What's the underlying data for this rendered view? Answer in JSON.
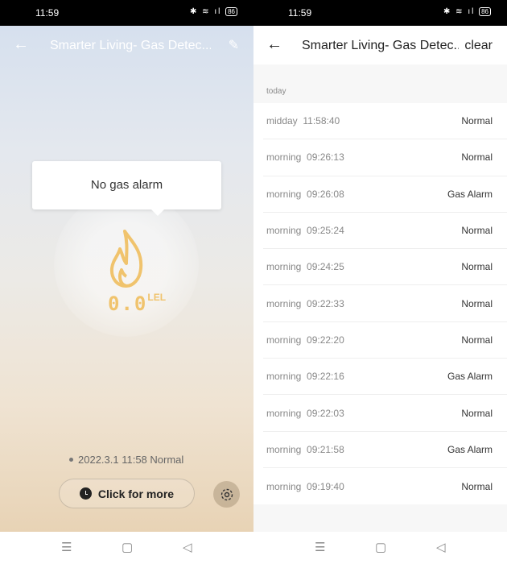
{
  "status_bar": {
    "time": "11:59",
    "battery": "86"
  },
  "left": {
    "header": {
      "title": "Smarter Living- Gas Detec..."
    },
    "bubble": "No gas alarm",
    "reading": {
      "value": "0.0",
      "unit": "LEL"
    },
    "last_record": "2022.3.1 11:58 Normal",
    "more_button": "Click for more",
    "accent": "#f0c36d"
  },
  "right": {
    "header": {
      "title": "Smarter Living- Gas Detec...",
      "clear": "clear"
    },
    "section": "today",
    "records": [
      {
        "period": "midday",
        "time": "11:58:40",
        "status": "Normal"
      },
      {
        "period": "morning",
        "time": "09:26:13",
        "status": "Normal"
      },
      {
        "period": "morning",
        "time": "09:26:08",
        "status": "Gas Alarm"
      },
      {
        "period": "morning",
        "time": "09:25:24",
        "status": "Normal"
      },
      {
        "period": "morning",
        "time": "09:24:25",
        "status": "Normal"
      },
      {
        "period": "morning",
        "time": "09:22:33",
        "status": "Normal"
      },
      {
        "period": "morning",
        "time": "09:22:20",
        "status": "Normal"
      },
      {
        "period": "morning",
        "time": "09:22:16",
        "status": "Gas Alarm"
      },
      {
        "period": "morning",
        "time": "09:22:03",
        "status": "Normal"
      },
      {
        "period": "morning",
        "time": "09:21:58",
        "status": "Gas Alarm"
      },
      {
        "period": "morning",
        "time": "09:19:40",
        "status": "Normal"
      }
    ]
  }
}
